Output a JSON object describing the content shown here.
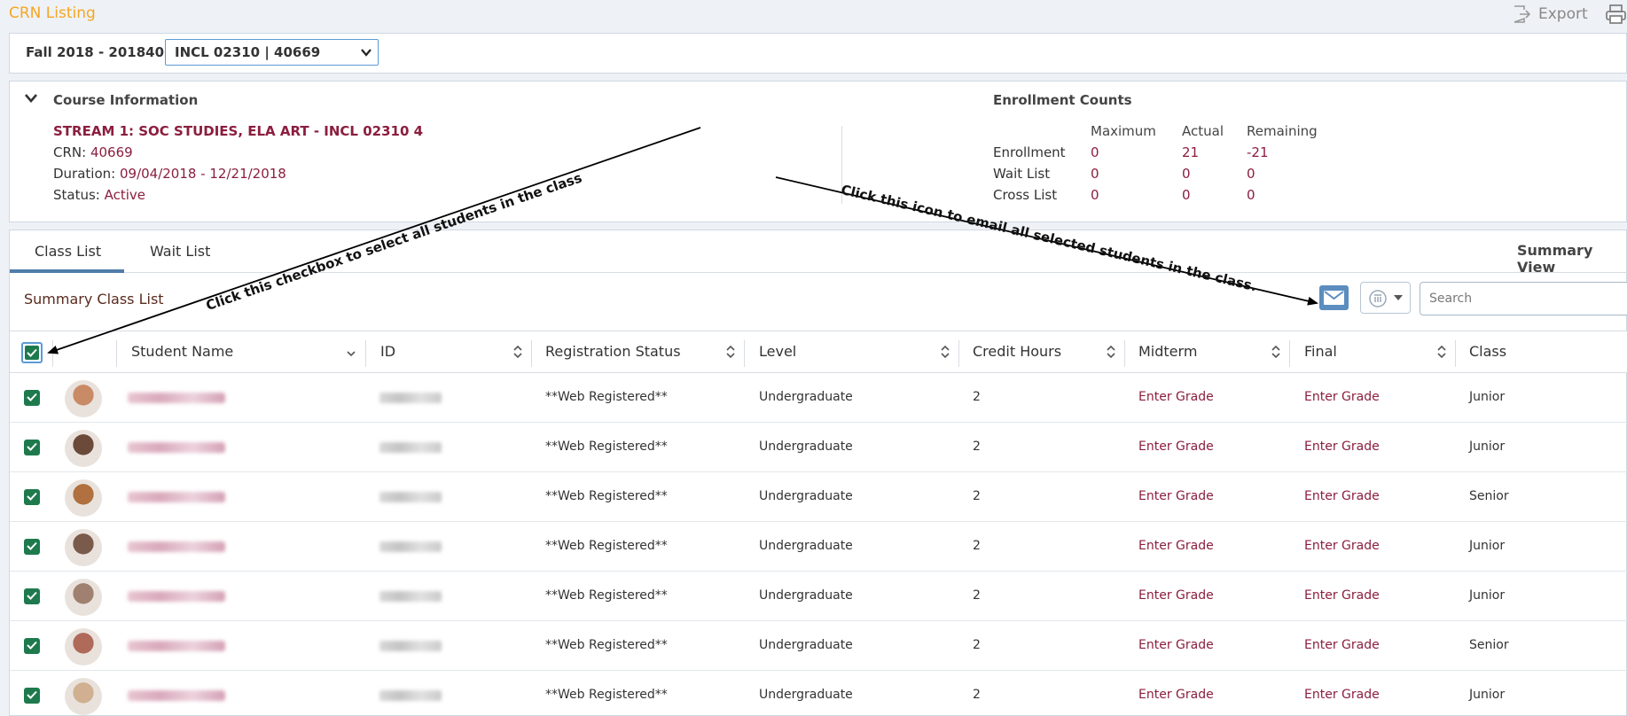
{
  "header": {
    "title": "CRN Listing",
    "export_label": "Export"
  },
  "term": {
    "label": "Fall 2018 - 201840",
    "selected_crn": "INCL 02310 | 40669"
  },
  "course_info": {
    "section_title": "Course Information",
    "course_name": "STREAM 1: SOC STUDIES, ELA ART - INCL 02310 4",
    "crn_label": "CRN:",
    "crn_value": "40669",
    "duration_label": "Duration:",
    "duration_value": "09/04/2018 - 12/21/2018",
    "status_label": "Status:",
    "status_value": "Active"
  },
  "enrollment": {
    "section_title": "Enrollment Counts",
    "headers": [
      "Maximum",
      "Actual",
      "Remaining"
    ],
    "rows": [
      {
        "label": "Enrollment",
        "values": [
          "0",
          "21",
          "-21"
        ]
      },
      {
        "label": "Wait List",
        "values": [
          "0",
          "0",
          "0"
        ]
      },
      {
        "label": "Cross List",
        "values": [
          "0",
          "0",
          "0"
        ]
      }
    ]
  },
  "tabs": [
    {
      "label": "Class List",
      "active": true
    },
    {
      "label": "Wait List",
      "active": false
    }
  ],
  "summary_view_label": "Summary View",
  "list_title": "Summary Class List",
  "search": {
    "placeholder": "Search"
  },
  "table": {
    "columns": [
      "Student Name",
      "ID",
      "Registration Status",
      "Level",
      "Credit Hours",
      "Midterm",
      "Final",
      "Class"
    ],
    "rows": [
      {
        "status": "**Web Registered**",
        "level": "Undergraduate",
        "credit_hours": "2",
        "midterm": "Enter Grade",
        "final": "Enter Grade",
        "class": "Junior"
      },
      {
        "status": "**Web Registered**",
        "level": "Undergraduate",
        "credit_hours": "2",
        "midterm": "Enter Grade",
        "final": "Enter Grade",
        "class": "Junior"
      },
      {
        "status": "**Web Registered**",
        "level": "Undergraduate",
        "credit_hours": "2",
        "midterm": "Enter Grade",
        "final": "Enter Grade",
        "class": "Senior"
      },
      {
        "status": "**Web Registered**",
        "level": "Undergraduate",
        "credit_hours": "2",
        "midterm": "Enter Grade",
        "final": "Enter Grade",
        "class": "Junior"
      },
      {
        "status": "**Web Registered**",
        "level": "Undergraduate",
        "credit_hours": "2",
        "midterm": "Enter Grade",
        "final": "Enter Grade",
        "class": "Junior"
      },
      {
        "status": "**Web Registered**",
        "level": "Undergraduate",
        "credit_hours": "2",
        "midterm": "Enter Grade",
        "final": "Enter Grade",
        "class": "Senior"
      },
      {
        "status": "**Web Registered**",
        "level": "Undergraduate",
        "credit_hours": "2",
        "midterm": "Enter Grade",
        "final": "Enter Grade",
        "class": "Junior"
      }
    ]
  },
  "annotations": {
    "checkbox_note": "Click this checkbox to select all students in the class",
    "email_note": "Click this icon to email all selected students in the class."
  },
  "colors": {
    "accent": "#f5a623",
    "link": "#8b1e3f",
    "checkbox": "#1e7a4d",
    "email_button": "#5b8dbf"
  }
}
